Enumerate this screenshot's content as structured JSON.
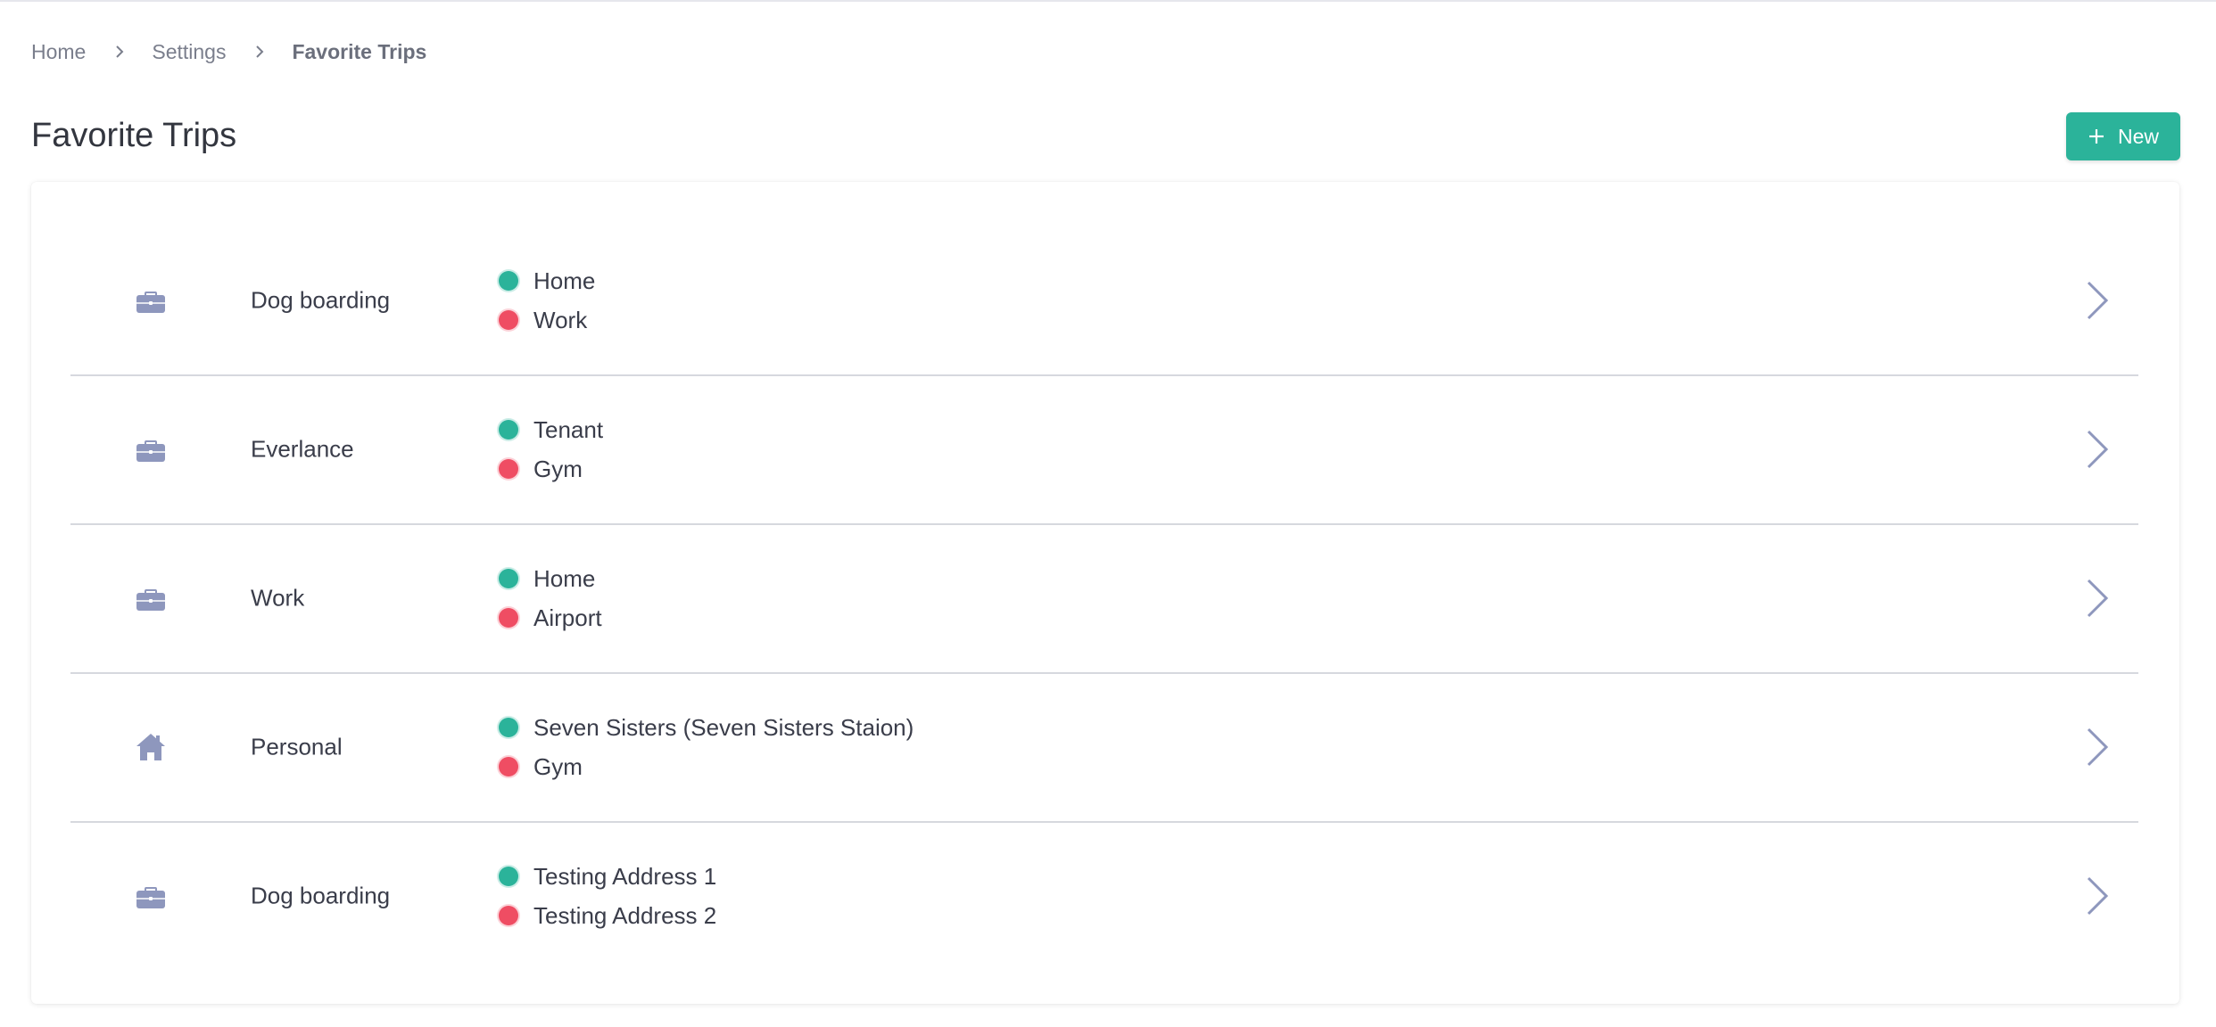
{
  "breadcrumb": {
    "items": [
      "Home",
      "Settings",
      "Favorite Trips"
    ]
  },
  "page": {
    "title": "Favorite Trips"
  },
  "toolbar": {
    "new_label": "New"
  },
  "colors": {
    "accent": "#2bb39a",
    "origin_dot": "#2bb39a",
    "destination_dot": "#ef4d63",
    "icon": "#8e97bd",
    "divider": "#d6d8de"
  },
  "trips": [
    {
      "name": "Dog boarding",
      "icon": "briefcase-icon",
      "origin": "Home",
      "destination": "Work"
    },
    {
      "name": "Everlance",
      "icon": "briefcase-icon",
      "origin": "Tenant",
      "destination": "Gym"
    },
    {
      "name": "Work",
      "icon": "briefcase-icon",
      "origin": "Home",
      "destination": "Airport"
    },
    {
      "name": "Personal",
      "icon": "home-icon",
      "origin": "Seven Sisters (Seven Sisters Staion)",
      "destination": "Gym"
    },
    {
      "name": "Dog boarding",
      "icon": "briefcase-icon",
      "origin": "Testing Address 1",
      "destination": "Testing Address 2"
    }
  ]
}
